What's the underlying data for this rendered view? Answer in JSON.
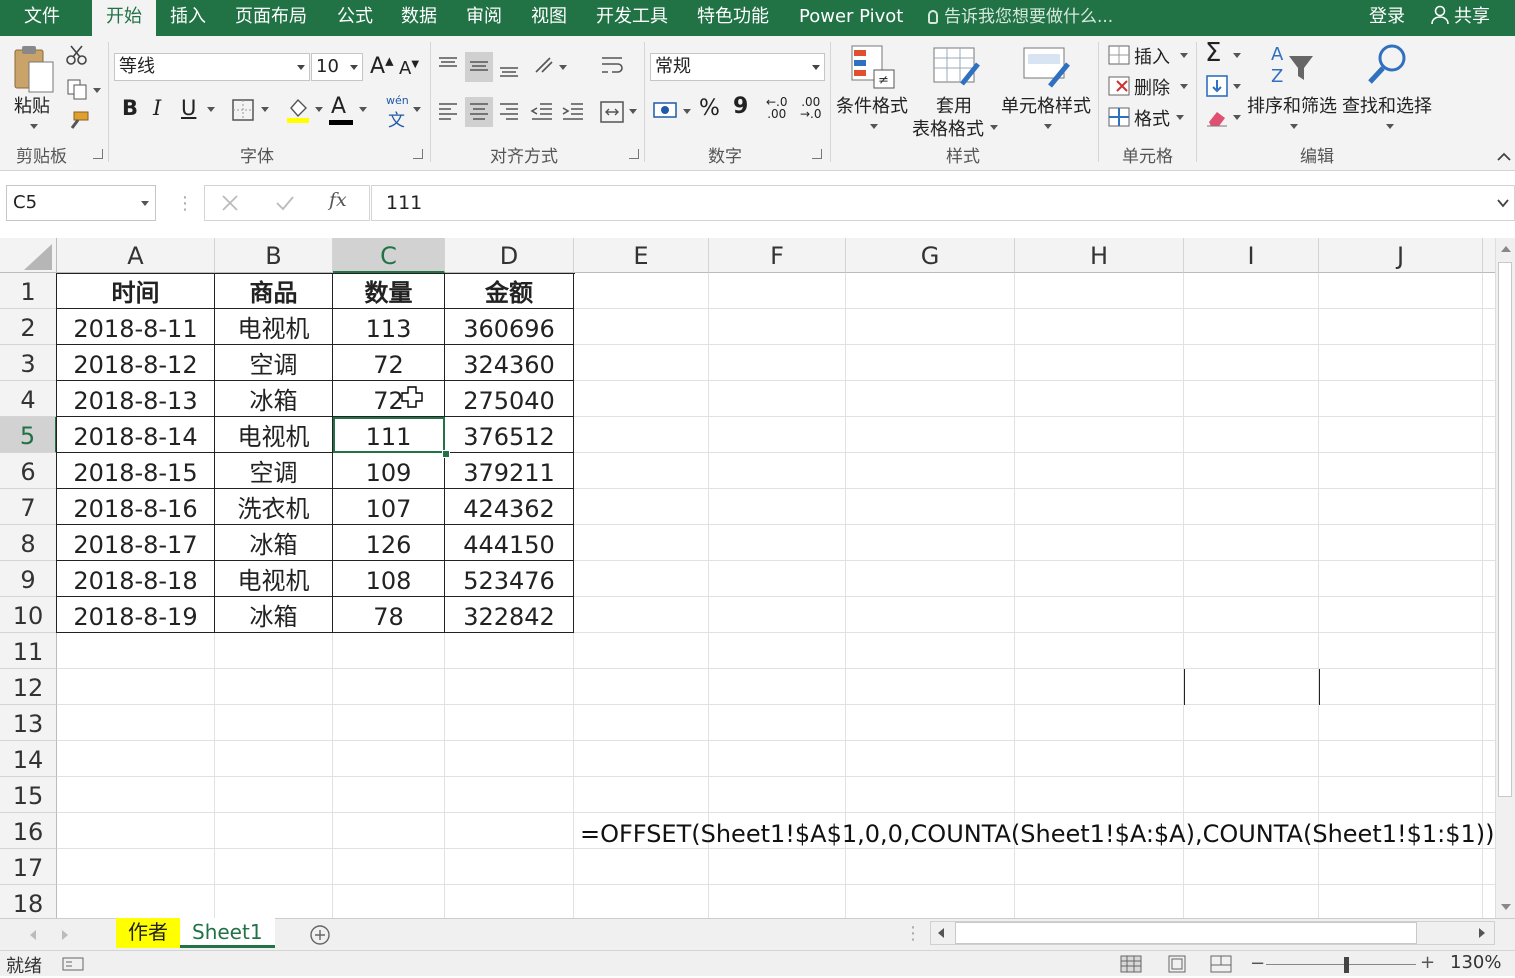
{
  "tabs": [
    "文件",
    "开始",
    "插入",
    "页面布局",
    "公式",
    "数据",
    "审阅",
    "视图",
    "开发工具",
    "特色功能",
    "Power Pivot"
  ],
  "tell_me": "告诉我您想要做什么...",
  "login": "登录",
  "share": "共享",
  "ribbon": {
    "paste": "粘贴",
    "clipboard": "剪贴板",
    "font_name": "等线",
    "font_size": "10",
    "bold": "B",
    "italic": "I",
    "underline": "U",
    "font": "字体",
    "wen": "wén",
    "wen_char": "文",
    "alignment": "对齐方式",
    "number_format": "常规",
    "percent": "%",
    "comma": "9",
    "number": "数字",
    "cond_format": "条件格式",
    "table_format_1": "套用",
    "table_format_2": "表格格式",
    "cell_styles": "单元格样式",
    "styles": "样式",
    "insert": "插入",
    "delete": "删除",
    "format": "格式",
    "cells": "单元格",
    "sort_filter": "排序和筛选",
    "find_select": "查找和选择",
    "editing": "编辑",
    "inc_dec_1": "←.0",
    "inc_dec_2": ".00",
    "dec_dec_1": ".00",
    "dec_dec_2": "→.0"
  },
  "formula_bar": {
    "name_box": "C5",
    "fx": "fx",
    "value": "111"
  },
  "columns": [
    "A",
    "B",
    "C",
    "D",
    "E",
    "F",
    "G",
    "H",
    "I",
    "J"
  ],
  "rows": [
    "1",
    "2",
    "3",
    "4",
    "5",
    "6",
    "7",
    "8",
    "9",
    "10",
    "11",
    "12",
    "13",
    "14",
    "15",
    "16",
    "17",
    "18"
  ],
  "table": {
    "headers": [
      "时间",
      "商品",
      "数量",
      "金额"
    ],
    "rows": [
      [
        "2018-8-11",
        "电视机",
        "113",
        "360696"
      ],
      [
        "2018-8-12",
        "空调",
        "72",
        "324360"
      ],
      [
        "2018-8-13",
        "冰箱",
        "72",
        "275040"
      ],
      [
        "2018-8-14",
        "电视机",
        "111",
        "376512"
      ],
      [
        "2018-8-15",
        "空调",
        "109",
        "379211"
      ],
      [
        "2018-8-16",
        "洗衣机",
        "107",
        "424362"
      ],
      [
        "2018-8-17",
        "冰箱",
        "126",
        "444150"
      ],
      [
        "2018-8-18",
        "电视机",
        "108",
        "523476"
      ],
      [
        "2018-8-19",
        "冰箱",
        "78",
        "322842"
      ]
    ]
  },
  "formula_text": "=OFFSET(Sheet1!$A$1,0,0,COUNTA(Sheet1!$A:$A),COUNTA(Sheet1!$1:$1))",
  "sheet_tabs": [
    "作者",
    "Sheet1"
  ],
  "status": {
    "ready": "就绪",
    "zoom": "130%"
  },
  "colors": {
    "accent": "#217346",
    "author_tab": "#ffff00"
  }
}
